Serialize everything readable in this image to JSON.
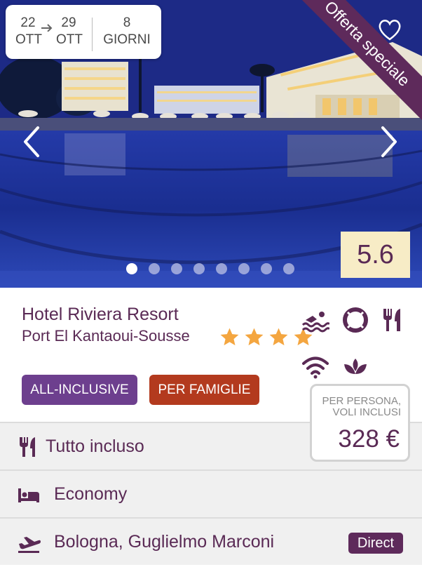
{
  "dates": {
    "start_day": "22",
    "start_month": "OTT",
    "end_day": "29",
    "end_month": "OTT",
    "duration_number": "8",
    "duration_unit": "GIORNI"
  },
  "ribbon": "Offerta speciale",
  "score": "5.6",
  "carousel": {
    "slides": 8,
    "active_index": 0
  },
  "hotel": {
    "name": "Hotel Riviera Resort",
    "location": "Port El Kantaoui-Sousse",
    "stars": 4
  },
  "amenities": [
    "swimming-icon",
    "lifebuoy-icon",
    "restaurant-icon",
    "wifi-icon",
    "spa-icon"
  ],
  "tags": {
    "all_inclusive": "ALL-INCLUSIVE",
    "families": "PER FAMIGLIE"
  },
  "rows": {
    "board": "Tutto incluso",
    "room": "Economy",
    "flight": "Bologna, Guglielmo Marconi",
    "flight_badge": "Direct"
  },
  "price": {
    "label_line1": "PER PERSONA,",
    "label_line2": "VOLI INCLUSI",
    "value": "328 €"
  },
  "colors": {
    "brand_purple": "#5e2a5b",
    "tag_all_inclusive": "#6d3f8e",
    "tag_families": "#b33a1e",
    "star": "#f4a640",
    "score_bg": "#f7ecc6"
  }
}
